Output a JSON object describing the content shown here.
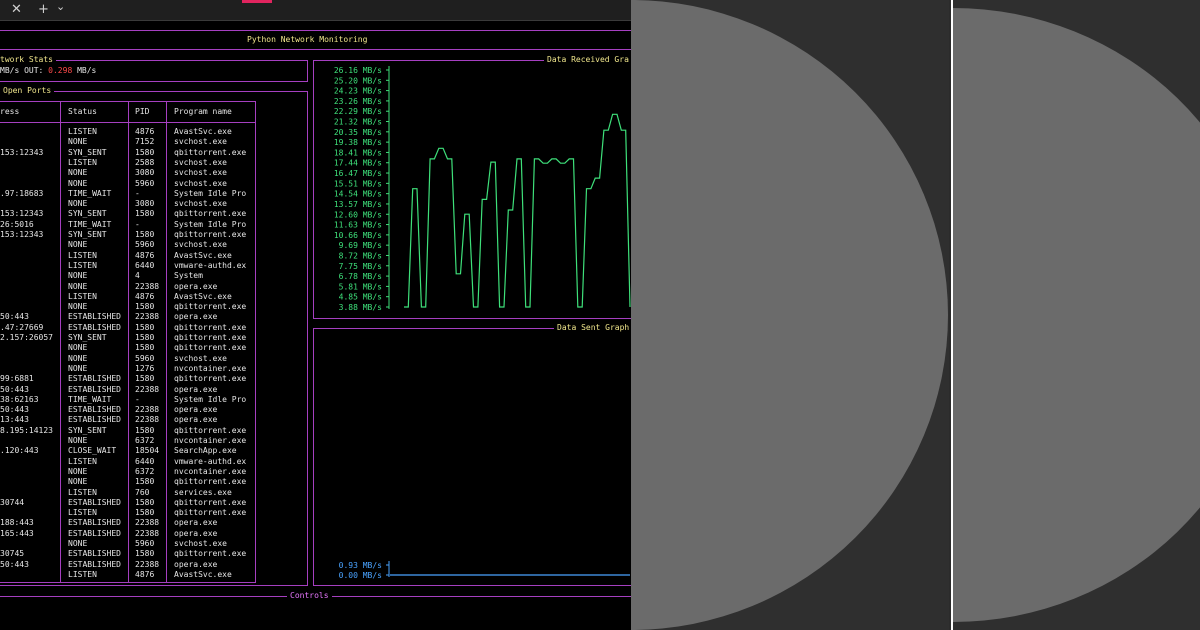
{
  "tabbar": {
    "close_glyph": "✕",
    "new_tab_glyph": "+",
    "dropdown_glyph": "⌄"
  },
  "app": {
    "title": "Python Network Monitoring",
    "stats_title": "twork Stats",
    "stats_line_prefix": "MB/s OUT: ",
    "stats_out_value": "0.298",
    "stats_out_unit": " MB/s",
    "ports_title": "Open Ports",
    "received_title": "Data Received Gra",
    "sent_title": "Data Sent Graph",
    "controls_label": "Controls"
  },
  "table": {
    "headers": [
      "ress",
      "Status",
      "PID",
      "Program name"
    ],
    "rows": [
      [
        "",
        "LISTEN",
        "4876",
        "AvastSvc.exe"
      ],
      [
        "",
        "NONE",
        "7152",
        "svchost.exe"
      ],
      [
        "153:12343",
        "SYN_SENT",
        "1580",
        "qbittorrent.exe"
      ],
      [
        "",
        "LISTEN",
        "2588",
        "svchost.exe"
      ],
      [
        "",
        "NONE",
        "3080",
        "svchost.exe"
      ],
      [
        "",
        "NONE",
        "5960",
        "svchost.exe"
      ],
      [
        ".97:18683",
        "TIME_WAIT",
        "-",
        "System Idle Pro"
      ],
      [
        "",
        "NONE",
        "3080",
        "svchost.exe"
      ],
      [
        "153:12343",
        "SYN_SENT",
        "1580",
        "qbittorrent.exe"
      ],
      [
        "26:5016",
        "TIME_WAIT",
        "-",
        "System Idle Pro"
      ],
      [
        "153:12343",
        "SYN_SENT",
        "1580",
        "qbittorrent.exe"
      ],
      [
        "",
        "NONE",
        "5960",
        "svchost.exe"
      ],
      [
        "",
        "LISTEN",
        "4876",
        "AvastSvc.exe"
      ],
      [
        "",
        "LISTEN",
        "6440",
        "vmware-authd.ex"
      ],
      [
        "",
        "NONE",
        "4",
        "System"
      ],
      [
        "",
        "NONE",
        "22388",
        "opera.exe"
      ],
      [
        "",
        "LISTEN",
        "4876",
        "AvastSvc.exe"
      ],
      [
        "",
        "NONE",
        "1580",
        "qbittorrent.exe"
      ],
      [
        "50:443",
        "ESTABLISHED",
        "22388",
        "opera.exe"
      ],
      [
        ".47:27669",
        "ESTABLISHED",
        "1580",
        "qbittorrent.exe"
      ],
      [
        "2.157:26057",
        "SYN_SENT",
        "1580",
        "qbittorrent.exe"
      ],
      [
        "",
        "NONE",
        "1580",
        "qbittorrent.exe"
      ],
      [
        "",
        "NONE",
        "5960",
        "svchost.exe"
      ],
      [
        "",
        "NONE",
        "1276",
        "nvcontainer.exe"
      ],
      [
        "99:6881",
        "ESTABLISHED",
        "1580",
        "qbittorrent.exe"
      ],
      [
        "50:443",
        "ESTABLISHED",
        "22388",
        "opera.exe"
      ],
      [
        "38:62163",
        "TIME_WAIT",
        "-",
        "System Idle Pro"
      ],
      [
        "50:443",
        "ESTABLISHED",
        "22388",
        "opera.exe"
      ],
      [
        "13:443",
        "ESTABLISHED",
        "22388",
        "opera.exe"
      ],
      [
        "8.195:14123",
        "SYN_SENT",
        "1580",
        "qbittorrent.exe"
      ],
      [
        "",
        "NONE",
        "6372",
        "nvcontainer.exe"
      ],
      [
        ".120:443",
        "CLOSE_WAIT",
        "18504",
        "SearchApp.exe"
      ],
      [
        "",
        "LISTEN",
        "6440",
        "vmware-authd.ex"
      ],
      [
        "",
        "NONE",
        "6372",
        "nvcontainer.exe"
      ],
      [
        "",
        "NONE",
        "1580",
        "qbittorrent.exe"
      ],
      [
        "",
        "LISTEN",
        "760",
        "services.exe"
      ],
      [
        "30744",
        "ESTABLISHED",
        "1580",
        "qbittorrent.exe"
      ],
      [
        "",
        "LISTEN",
        "1580",
        "qbittorrent.exe"
      ],
      [
        "188:443",
        "ESTABLISHED",
        "22388",
        "opera.exe"
      ],
      [
        "165:443",
        "ESTABLISHED",
        "22388",
        "opera.exe"
      ],
      [
        "",
        "NONE",
        "5960",
        "svchost.exe"
      ],
      [
        "30745",
        "ESTABLISHED",
        "1580",
        "qbittorrent.exe"
      ],
      [
        "50:443",
        "ESTABLISHED",
        "22388",
        "opera.exe"
      ],
      [
        "",
        "LISTEN",
        "4876",
        "AvastSvc.exe"
      ]
    ]
  },
  "chart_data": [
    {
      "type": "line",
      "title": "Data Received Gra",
      "y_ticks": [
        "26.16 MB/s",
        "25.20 MB/s",
        "24.23 MB/s",
        "23.26 MB/s",
        "22.29 MB/s",
        "21.32 MB/s",
        "20.35 MB/s",
        "19.38 MB/s",
        "18.41 MB/s",
        "17.44 MB/s",
        "16.47 MB/s",
        "15.51 MB/s",
        "14.54 MB/s",
        "13.57 MB/s",
        "12.60 MB/s",
        "11.63 MB/s",
        "10.66 MB/s",
        "9.69 MB/s",
        "8.72 MB/s",
        "7.75 MB/s",
        "6.78 MB/s",
        "5.81 MB/s",
        "4.85 MB/s",
        "3.88 MB/s"
      ],
      "ylim": [
        3.88,
        26.16
      ],
      "series": [
        {
          "values": [
            3.88,
            3.88,
            15.0,
            15.0,
            3.88,
            3.88,
            17.8,
            17.8,
            18.8,
            18.8,
            17.8,
            17.8,
            7.0,
            7.0,
            12.6,
            12.6,
            3.88,
            3.88,
            14.0,
            14.0,
            17.5,
            17.5,
            3.88,
            3.88,
            13.0,
            13.0,
            17.8,
            17.8,
            3.88,
            3.88,
            17.8,
            17.8,
            17.4,
            17.4,
            17.8,
            17.8,
            17.4,
            17.4,
            17.8,
            17.8,
            3.88,
            3.88,
            15.0,
            15.0,
            16.0,
            16.0,
            20.5,
            20.5,
            22.0,
            22.0,
            20.5,
            20.5,
            3.88
          ]
        }
      ]
    },
    {
      "type": "line",
      "title": "Data Sent Graph",
      "y_ticks": [
        "0.93 MB/s",
        "0.00 MB/s"
      ],
      "ylim": [
        0.0,
        0.93
      ],
      "series": [
        {
          "values": [
            0.0,
            0.0
          ]
        }
      ]
    }
  ]
}
